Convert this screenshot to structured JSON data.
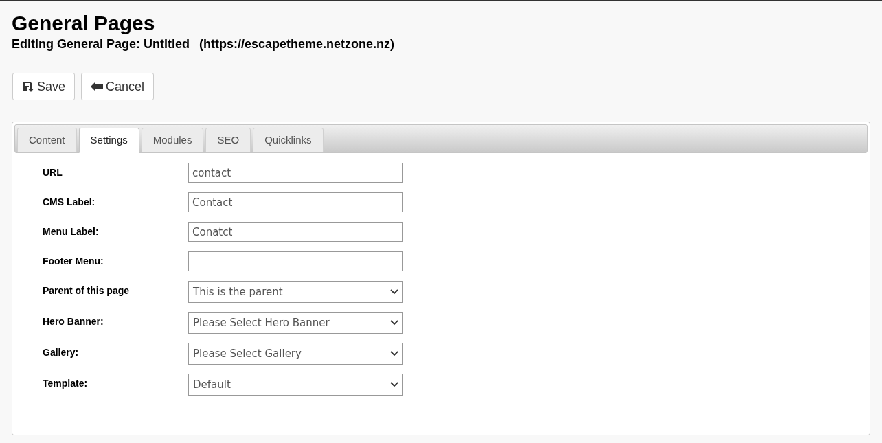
{
  "header": {
    "title": "General Pages",
    "subtitle": "Editing General Page: Untitled",
    "site_url": "(https://escapetheme.netzone.nz)"
  },
  "buttons": [
    {
      "kind": "save",
      "label": "Save"
    },
    {
      "kind": "cancel",
      "label": "Cancel"
    }
  ],
  "tabs": [
    {
      "label": "Content",
      "selected": false
    },
    {
      "label": "Settings",
      "selected": true
    },
    {
      "label": "Modules",
      "selected": false
    },
    {
      "label": "SEO",
      "selected": false
    },
    {
      "label": "Quicklinks",
      "selected": false
    }
  ],
  "fields": [
    {
      "kind": "text",
      "label": "URL",
      "value": "contact"
    },
    {
      "kind": "text",
      "label": "CMS Label:",
      "value": "Contact"
    },
    {
      "kind": "text",
      "label": "Menu Label:",
      "value": "Conatct"
    },
    {
      "kind": "text",
      "label": "Footer Menu:"
    },
    {
      "kind": "select",
      "label": "Parent of this page",
      "value": "This is the parent"
    },
    {
      "kind": "select",
      "label": "Hero Banner:",
      "value": "Please Select Hero Banner"
    },
    {
      "kind": "select",
      "label": "Gallery:",
      "value": "Please Select Gallery"
    },
    {
      "kind": "select",
      "label": "Template:",
      "value": "Default"
    }
  ]
}
